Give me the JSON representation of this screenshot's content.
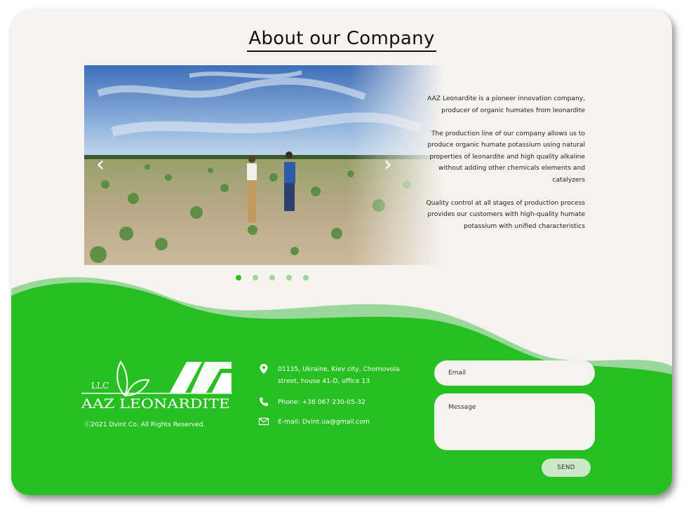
{
  "colors": {
    "accent_green": "#27bf22",
    "light_green": "#9ad79a",
    "background": "#f6f3ef",
    "send_button": "#cde8c8"
  },
  "about": {
    "title": "About our Company",
    "paragraphs": [
      "AAZ Leonardite is a pioneer innovation company, producer of organic humates from leonardite",
      "The production line of our company allows us to produce organic humate potassium using natural properties of leonardite and high quality alkaline without adding other chemicals elements and catalyzers",
      "Quality control at all stages of production process provides our customers with high-quality humate potassium with unified characteristics"
    ]
  },
  "slider": {
    "prev_icon": "chevron-left-icon",
    "next_icon": "chevron-right-icon",
    "prev_glyph": "‹",
    "next_glyph": "›",
    "slide_count": 5,
    "active_index": 0
  },
  "footer": {
    "logo": {
      "llc": "LLC",
      "brand": "AAZ LEONARDITE",
      "mark": "AAZ"
    },
    "copyright": "ⓒ2021 Dvint Co. All Rights Reserved.",
    "contacts": [
      {
        "icon": "location-pin-icon",
        "text": "01135, Ukraine, Kiev city, Chornovola street, house 41-D, office 13"
      },
      {
        "icon": "phone-icon",
        "text": "Phone: +38 067 230-05-32"
      },
      {
        "icon": "mail-icon",
        "text": "E-mail: Dvint.ua@gmail.com"
      }
    ],
    "form": {
      "email_placeholder": "Email",
      "message_placeholder": "Message",
      "send_label": "SEND"
    }
  }
}
